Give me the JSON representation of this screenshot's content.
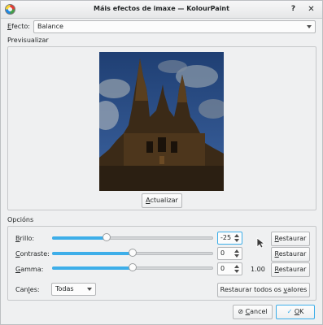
{
  "window": {
    "title": "Máis efectos de imaxe — KolourPaint"
  },
  "titlebar": {
    "help_icon": "help-icon",
    "close_icon": "close-icon"
  },
  "effect": {
    "label": "Efecto:",
    "selected": "Balance"
  },
  "preview": {
    "label": "Previsualizar",
    "update_button": "Actualizar"
  },
  "options": {
    "label": "Opcións",
    "brightness": {
      "label": "Brillo:",
      "value": "-25",
      "level": 0.34,
      "reset": "Restaurar"
    },
    "contrast": {
      "label": "Contraste:",
      "value": "0",
      "level": 0.5,
      "reset": "Restaurar"
    },
    "gamma": {
      "label": "Gamma:",
      "value": "0",
      "display": "1.00",
      "level": 0.5,
      "reset": "Restaurar"
    },
    "channels": {
      "label": "Canles:",
      "selected": "Todas"
    },
    "reset_all": "Restaurar todos os valores"
  },
  "footer": {
    "cancel": "Cancel",
    "ok": "OK"
  },
  "colors": {
    "accent": "#3daee9",
    "window_bg": "#eff0f1"
  }
}
